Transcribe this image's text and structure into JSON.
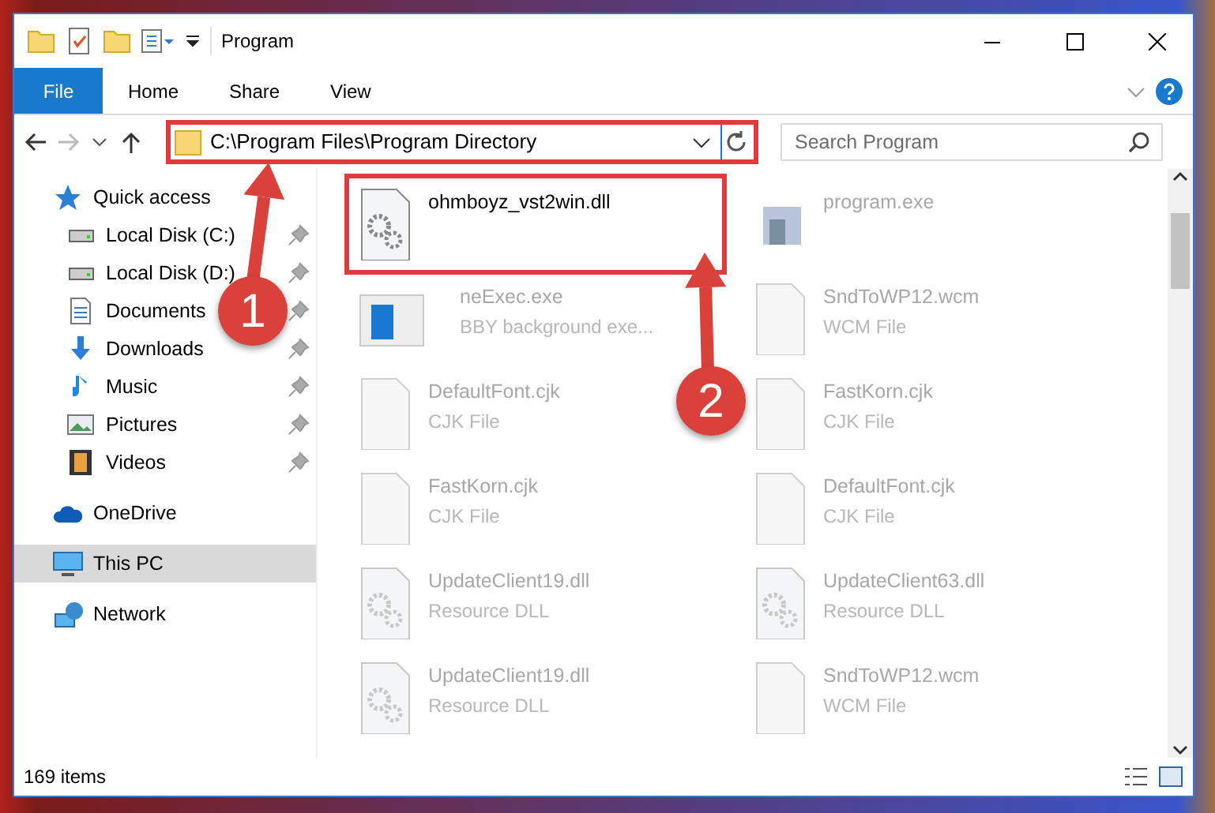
{
  "window": {
    "title": "Program"
  },
  "ribbon_tabs": [
    {
      "label": "File",
      "kind": "file"
    },
    {
      "label": "Home",
      "kind": "tab"
    },
    {
      "label": "Share",
      "kind": "tab"
    },
    {
      "label": "View",
      "kind": "tab"
    }
  ],
  "address": {
    "path": "C:\\Program Files\\Program Directory",
    "highlighted": true
  },
  "search": {
    "placeholder": "Search Program"
  },
  "sidebar": {
    "items": [
      {
        "label": "Quick access",
        "selected": false,
        "children": [
          {
            "label": "Local Disk (C:)",
            "pinned": true,
            "selected": false
          },
          {
            "label": "Local Disk (D:)",
            "pinned": true,
            "selected": false
          },
          {
            "label": "Documents",
            "pinned": true,
            "selected": false
          },
          {
            "label": "Downloads",
            "pinned": true,
            "selected": false
          },
          {
            "label": "Music",
            "pinned": true,
            "selected": false
          },
          {
            "label": "Pictures",
            "pinned": true,
            "selected": false
          },
          {
            "label": "Videos",
            "pinned": true,
            "selected": false
          }
        ]
      },
      {
        "label": "OneDrive",
        "selected": false
      },
      {
        "label": "This PC",
        "selected": true
      },
      {
        "label": "Network",
        "selected": false
      }
    ]
  },
  "files": [
    {
      "name": "ohmboyz_vst2win.dll",
      "kind": "dll",
      "dimmed": false,
      "highlighted": true
    },
    {
      "name": "program.exe",
      "kind": "exe",
      "dimmed": true,
      "highlighted": false
    },
    {
      "name": "neExec.exe",
      "type": "BBY background exe...",
      "kind": "service",
      "dimmed": true,
      "highlighted": false
    },
    {
      "name": "SndToWP12.wcm",
      "type": "WCM File",
      "kind": "file",
      "dimmed": true,
      "highlighted": false
    },
    {
      "name": "DefaultFont.cjk",
      "type": "CJK File",
      "kind": "file",
      "dimmed": true,
      "highlighted": false
    },
    {
      "name": "FastKorn.cjk",
      "type": "CJK File",
      "kind": "file",
      "dimmed": true,
      "highlighted": false
    },
    {
      "name": "FastKorn.cjk",
      "type": "CJK File",
      "kind": "file",
      "dimmed": true,
      "highlighted": false
    },
    {
      "name": "DefaultFont.cjk",
      "type": "CJK File",
      "kind": "file",
      "dimmed": true,
      "highlighted": false
    },
    {
      "name": "UpdateClient19.dll",
      "type": "Resource DLL",
      "kind": "dll",
      "dimmed": true,
      "highlighted": false
    },
    {
      "name": "UpdateClient63.dll",
      "type": "Resource DLL",
      "kind": "dll",
      "dimmed": true,
      "highlighted": false
    },
    {
      "name": "UpdateClient19.dll",
      "type": "Resource DLL",
      "kind": "dll",
      "dimmed": true,
      "highlighted": false
    },
    {
      "name": "SndToWP12.wcm",
      "type": "WCM File",
      "kind": "file",
      "dimmed": true,
      "highlighted": false
    }
  ],
  "steps": [
    {
      "number": "1"
    },
    {
      "number": "2"
    }
  ],
  "status_bar": {
    "item_count": "169 items"
  }
}
